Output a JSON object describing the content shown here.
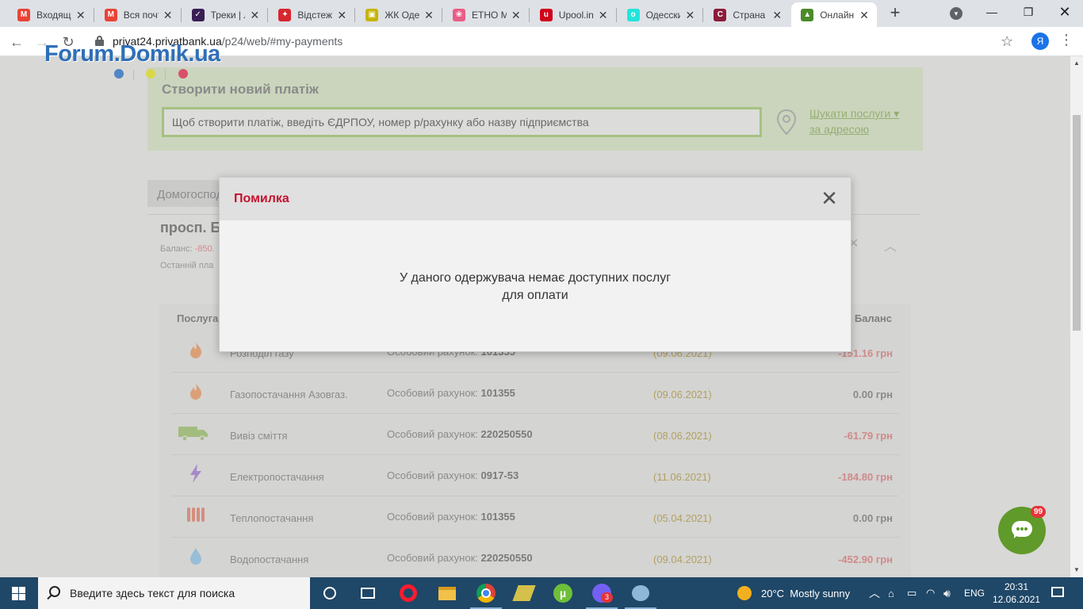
{
  "browser": {
    "tabs": [
      {
        "title": "Входящие",
        "icon": "gmail-icon",
        "color": "#ea4335",
        "glyph": "M"
      },
      {
        "title": "Вся почта",
        "icon": "gmail-icon",
        "color": "#ea4335",
        "glyph": "M"
      },
      {
        "title": "Треки | Л",
        "icon": "tracker-icon",
        "color": "#3b1e54",
        "glyph": "✓"
      },
      {
        "title": "Відстеж",
        "icon": "novaposhta-icon",
        "color": "#d7262e",
        "glyph": "✦"
      },
      {
        "title": "ЖК Оде",
        "icon": "building-icon",
        "color": "#c6b400",
        "glyph": "▣"
      },
      {
        "title": "ЕТНО Ма",
        "icon": "flower-icon",
        "color": "#e95d86",
        "glyph": "❀"
      },
      {
        "title": "Upool.in",
        "icon": "upool-icon",
        "color": "#d0021b",
        "glyph": "u"
      },
      {
        "title": "Одесски",
        "icon": "olx-icon",
        "color": "#23e5db",
        "glyph": "o"
      },
      {
        "title": "Страна",
        "icon": "strana-icon",
        "color": "#8c1c3a",
        "glyph": "C"
      },
      {
        "title": "Онлайн",
        "icon": "privat24-icon",
        "color": "#4c8b2b",
        "glyph": "▲"
      }
    ],
    "url_host": "privat24.privatbank.ua",
    "url_path": "/p24/web/#my-payments",
    "profile_initial": "Я"
  },
  "watermark": {
    "text": "Forum.Domik.ua"
  },
  "page": {
    "new_payment_title": "Створити новий платіж",
    "new_payment_placeholder": "Щоб створити платіж, введіть ЄДРПОУ, номер р/рахунку або назву підприємства",
    "search_by_address_line1": "Шукати послуги",
    "search_by_address_line2": "за адресою",
    "tab_home": "Домогосподарства",
    "address_title": "просп. Б",
    "balance_label": "Баланс:",
    "balance_value": "-850.",
    "last_payment_label": "Останній пла",
    "col_service": "Послуга",
    "col_balance": "Баланс",
    "services": [
      {
        "icon": "flame-icon",
        "name": "Розподіл газу",
        "account_label": "Особовий рахунок:",
        "account": "101355",
        "date": "(09.06.2021)",
        "balance": "-151.16 грн",
        "negative": true
      },
      {
        "icon": "flame-icon",
        "name": "Газопостачання Азовгаз.",
        "account_label": "Особовий рахунок:",
        "account": "101355",
        "date": "(09.06.2021)",
        "balance": "0.00 грн",
        "negative": false
      },
      {
        "icon": "garbage-truck-icon",
        "name": "Вивіз сміття",
        "account_label": "Особовий рахунок:",
        "account": "220250550",
        "date": "(08.06.2021)",
        "balance": "-61.79 грн",
        "negative": true
      },
      {
        "icon": "lightning-icon",
        "name": "Електропостачання",
        "account_label": "Особовий рахунок:",
        "account": "0917-53",
        "date": "(11.06.2021)",
        "balance": "-184.80 грн",
        "negative": true
      },
      {
        "icon": "radiator-icon",
        "name": "Теплопостачання",
        "account_label": "Особовий рахунок:",
        "account": "101355",
        "date": "(05.04.2021)",
        "balance": "0.00 грн",
        "negative": false
      },
      {
        "icon": "water-drop-icon",
        "name": "Водопостачання",
        "account_label": "Особовий рахунок:",
        "account": "220250550",
        "date": "(09.04.2021)",
        "balance": "-452.90 грн",
        "negative": true
      }
    ],
    "chat_badge": "99"
  },
  "modal": {
    "title": "Помилка",
    "close_glyph": "✕",
    "message_line1": "У даного одержувача немає доступних послуг",
    "message_line2": "для оплати"
  },
  "taskbar": {
    "search_placeholder": "Введите здесь текст для поиска",
    "weather": "20°C  Mostly sunny",
    "language": "ENG",
    "time": "20:31",
    "date": "12.06.2021",
    "viber_badge": "3"
  }
}
